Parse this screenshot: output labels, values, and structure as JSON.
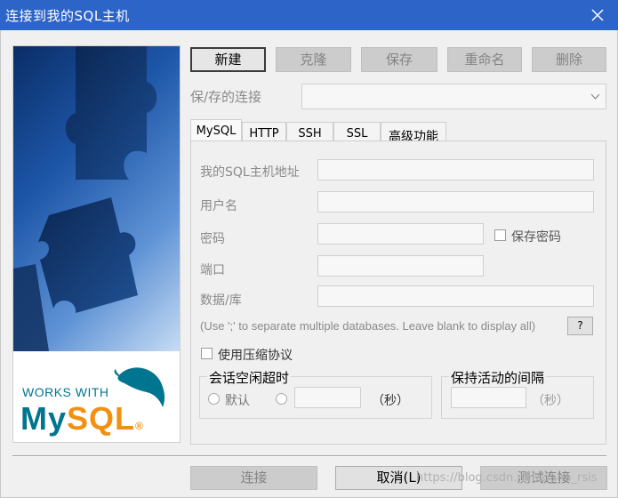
{
  "window": {
    "title": "连接到我的SQL主机",
    "close_icon": "close-icon"
  },
  "side_panel": {
    "brand_line1": "WORKS WITH",
    "brand_logo_text": "MySQL",
    "brand_suffix": "®"
  },
  "toolbar": {
    "new_label": "新建",
    "clone_label": "克隆",
    "save_label": "保存",
    "rename_label": "重命名",
    "delete_label": "删除"
  },
  "saved_connections": {
    "label": "保/存的连接",
    "value": ""
  },
  "tabs": [
    {
      "label": "MySQL",
      "active": true
    },
    {
      "label": "HTTP",
      "active": false
    },
    {
      "label": "SSH",
      "active": false
    },
    {
      "label": "SSL",
      "active": false
    },
    {
      "label": "高级功能",
      "active": false
    }
  ],
  "form": {
    "host_label": "我的SQL主机地址",
    "host_value": "",
    "user_label": "用户名",
    "user_value": "",
    "password_label": "密码",
    "password_value": "",
    "save_password_label": "保存密码",
    "port_label": "端口",
    "port_value": "",
    "database_label": "数据/库",
    "database_value": "",
    "database_hint": "(Use ';' to separate multiple databases. Leave blank to display all)",
    "help_label": "?",
    "compression_label": "使用压缩协议"
  },
  "session_timeout": {
    "title": "会话空闲超时",
    "default_label": "默认",
    "value": "",
    "unit": "（秒）"
  },
  "keepalive": {
    "title": "保持活动的间隔",
    "value": "",
    "unit": "（秒）"
  },
  "footer": {
    "connect_label": "连接",
    "cancel_label": "取消(L)",
    "test_label": "测试连接",
    "watermark": "https://blog.csdn.net/xiaha_rsis"
  },
  "colors": {
    "titlebar": "#2c64c8",
    "mysql_blue": "#00758f",
    "mysql_orange": "#f29111"
  }
}
